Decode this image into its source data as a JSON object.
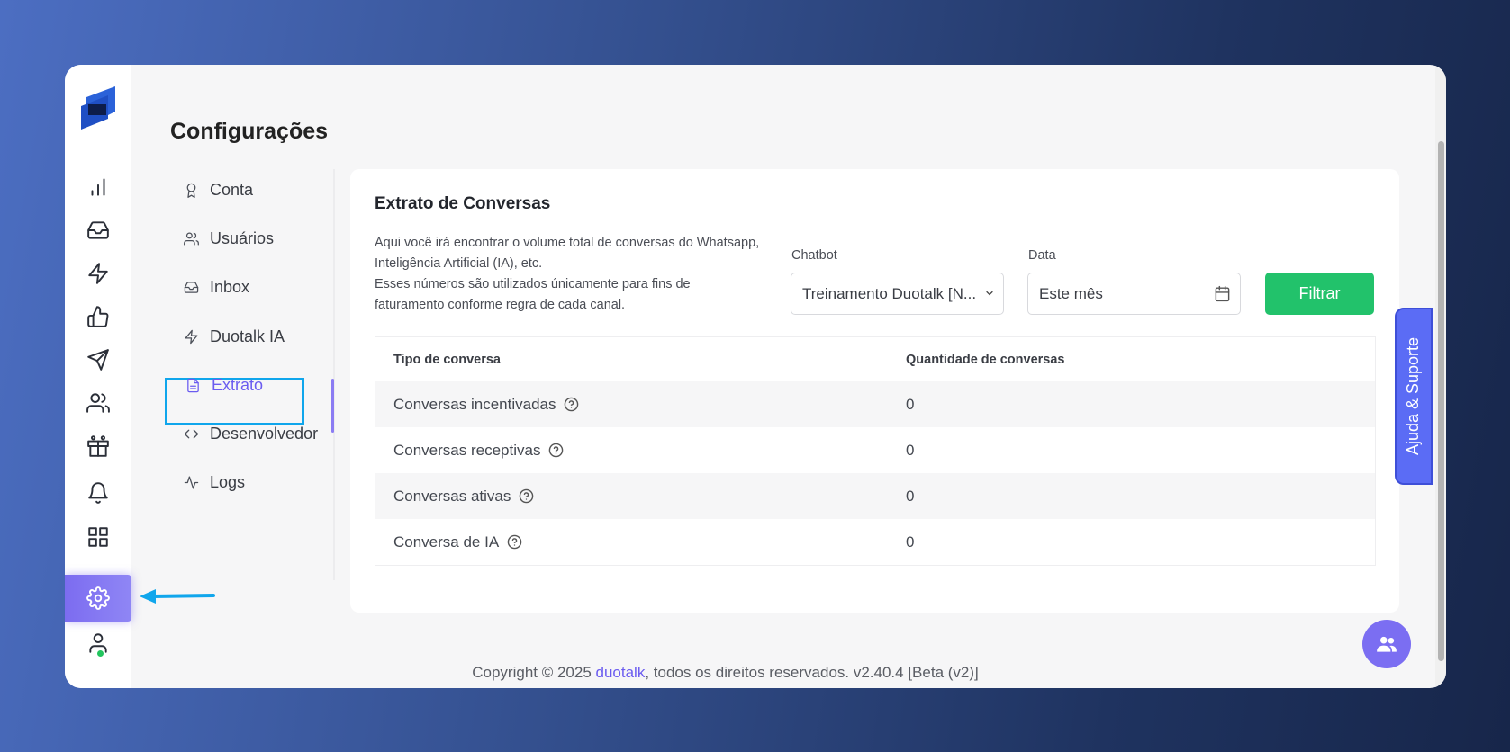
{
  "page": {
    "title": "Configurações"
  },
  "submenu": {
    "items": [
      {
        "label": "Conta",
        "icon": "award-icon"
      },
      {
        "label": "Usuários",
        "icon": "users-icon"
      },
      {
        "label": "Inbox",
        "icon": "inbox-icon"
      },
      {
        "label": "Duotalk IA",
        "icon": "zap-icon"
      },
      {
        "label": "Extrato",
        "icon": "file-text-icon",
        "active": true
      },
      {
        "label": "Desenvolvedor",
        "icon": "code-icon"
      },
      {
        "label": "Logs",
        "icon": "activity-icon"
      }
    ]
  },
  "card": {
    "title": "Extrato de Conversas",
    "description_lines": [
      "Aqui você irá encontrar o volume total de conversas do Whatsapp,",
      "Inteligência Artificial (IA), etc.",
      "Esses números são utilizados únicamente para fins de",
      "faturamento conforme regra de cada canal."
    ],
    "chatbot_label": "Chatbot",
    "chatbot_value": "Treinamento Duotalk [N...",
    "date_label": "Data",
    "date_value": "Este mês",
    "filter_label": "Filtrar",
    "table": {
      "headers": [
        "Tipo de conversa",
        "Quantidade de conversas"
      ],
      "rows": [
        {
          "type": "Conversas incentivadas",
          "count": "0"
        },
        {
          "type": "Conversas receptivas",
          "count": "0"
        },
        {
          "type": "Conversas ativas",
          "count": "0"
        },
        {
          "type": "Conversa de IA",
          "count": "0"
        }
      ]
    }
  },
  "help_tab": {
    "label": "Ajuda & Suporte"
  },
  "footer": {
    "prefix": "Copyright © 2025 ",
    "brand": "duotalk",
    "suffix": ", todos os direitos reservados. v2.40.4 [Beta (v2)]"
  },
  "colors": {
    "accent": "#6b5cf0",
    "filter": "#22c26b",
    "highlight": "#10a6ec",
    "online": "#22c55e"
  }
}
